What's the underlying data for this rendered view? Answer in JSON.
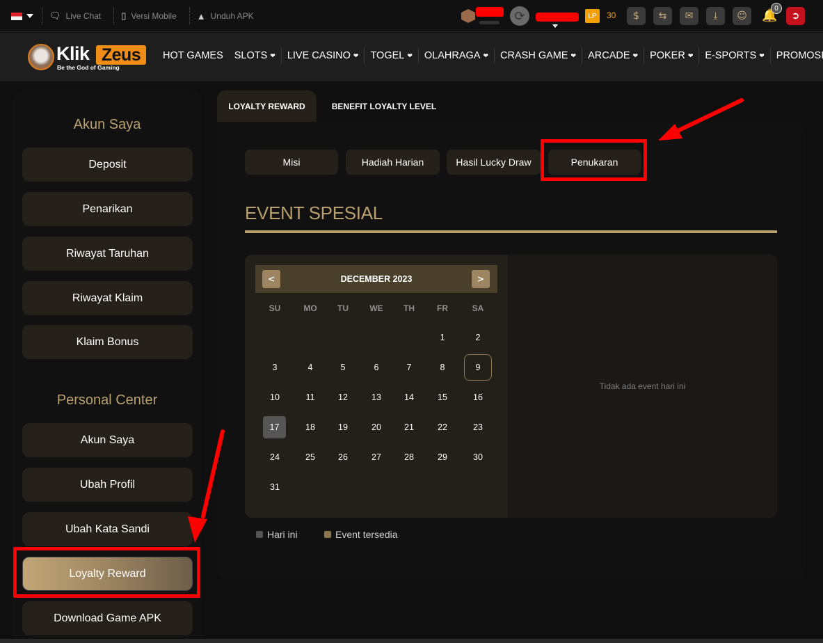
{
  "topbar": {
    "language": {
      "flag": "indonesia-flag"
    },
    "links": [
      {
        "label": "Live Chat",
        "icon": "chat-icon"
      },
      {
        "label": "Versi Mobile",
        "icon": "mobile-icon"
      },
      {
        "label": "Unduh APK",
        "icon": "android-icon"
      }
    ],
    "lp_badge": "LP",
    "lp_value": "30",
    "notification_count": "0",
    "icons": [
      "cashback-icon",
      "transfer-icon",
      "mail-icon",
      "download-icon",
      "profile-icon",
      "bell-icon",
      "logout-icon"
    ]
  },
  "brand": {
    "name_part1": "Klik",
    "name_part2": "Zeus",
    "tagline": "Be the God of Gaming"
  },
  "nav": {
    "items": [
      {
        "label": "HOT GAMES",
        "dropdown": false
      },
      {
        "label": "SLOTS",
        "dropdown": true
      },
      {
        "label": "LIVE CASINO",
        "dropdown": true
      },
      {
        "label": "TOGEL",
        "dropdown": true
      },
      {
        "label": "OLAHRAGA",
        "dropdown": true
      },
      {
        "label": "CRASH GAME",
        "dropdown": true
      },
      {
        "label": "ARCADE",
        "dropdown": true
      },
      {
        "label": "POKER",
        "dropdown": true
      },
      {
        "label": "E-SPORTS",
        "dropdown": true
      },
      {
        "label": "PROMOSI",
        "dropdown": false
      }
    ]
  },
  "sidebar": {
    "section1_title": "Akun Saya",
    "section1_items": [
      "Deposit",
      "Penarikan",
      "Riwayat Taruhan",
      "Riwayat Klaim",
      "Klaim Bonus"
    ],
    "section2_title": "Personal Center",
    "section2_items": [
      "Akun Saya",
      "Ubah Profil",
      "Ubah Kata Sandi",
      "Loyalty Reward",
      "Download Game APK"
    ],
    "active_item": "Loyalty Reward"
  },
  "tabs": [
    {
      "label": "LOYALTY REWARD",
      "active": true
    },
    {
      "label": "BENEFIT LOYALTY LEVEL",
      "active": false
    }
  ],
  "subtabs": [
    "Misi",
    "Hadiah Harian",
    "Hasil Lucky Draw",
    "Penukaran"
  ],
  "highlighted_subtab": "Penukaran",
  "event": {
    "title": "EVENT SPESIAL",
    "calendar": {
      "month_label": "DECEMBER 2023",
      "prev": "<",
      "next": ">",
      "weekdays": [
        "SU",
        "MO",
        "TU",
        "WE",
        "TH",
        "FR",
        "SA"
      ],
      "first_weekday_index": 5,
      "days_in_month": 31,
      "today": 17,
      "selected": 9
    },
    "empty_message": "Tidak ada event hari ini",
    "legend": [
      {
        "label": "Hari ini",
        "color": "#555555"
      },
      {
        "label": "Event tersedia",
        "color": "#8c7650"
      }
    ]
  },
  "colors": {
    "accent_gold": "#b9a06f",
    "button_bg": "#25201a",
    "annotation_red": "#ff0000",
    "lp_orange": "#f5a000"
  }
}
